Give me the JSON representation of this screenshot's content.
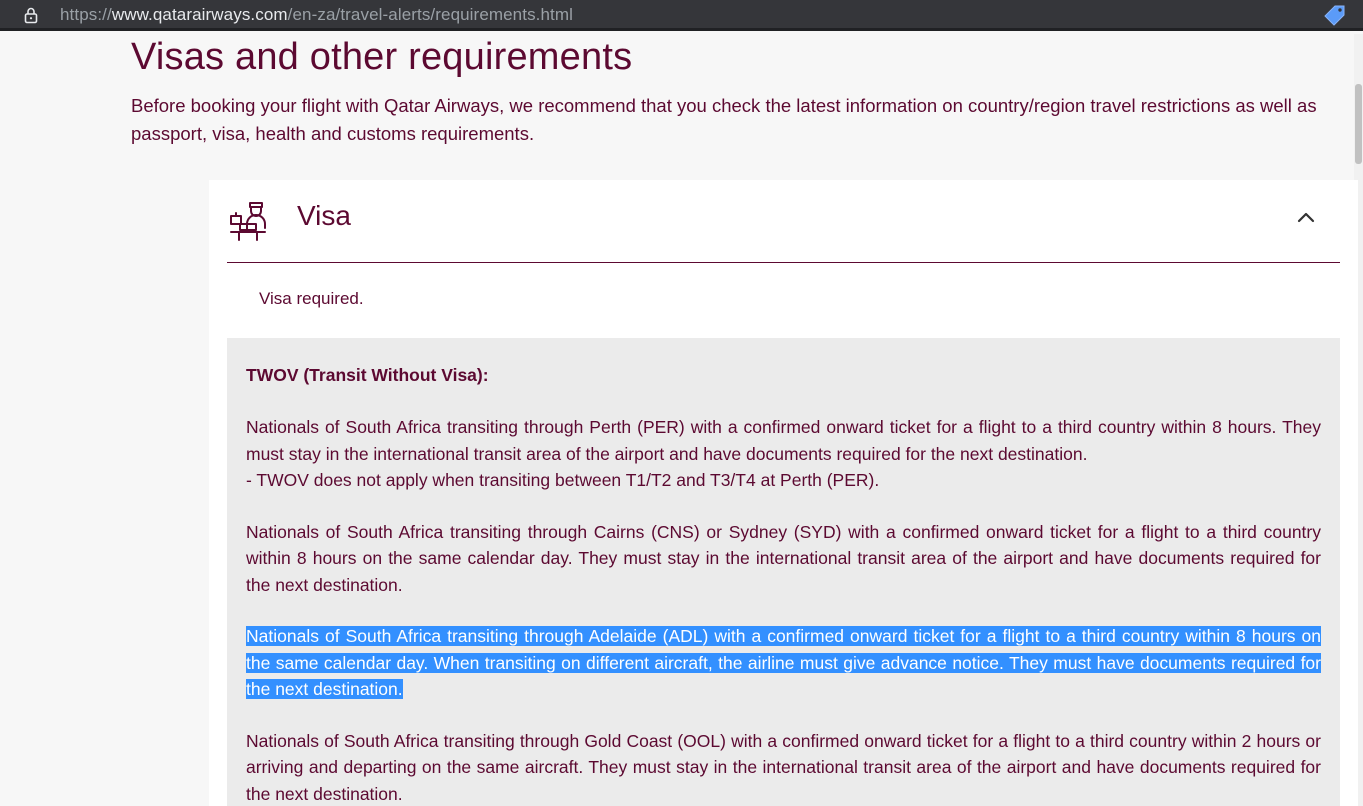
{
  "browser": {
    "url_prefix": "https://",
    "url_host": "www.qatarairways.com",
    "url_path": "/en-za/travel-alerts/requirements.html"
  },
  "page": {
    "title": "Visas and other requirements",
    "intro": "Before booking your flight with Qatar Airways, we recommend that you check the latest information on country/region travel restrictions as well as passport, visa, health and customs requirements."
  },
  "visa_section": {
    "title": "Visa",
    "requirement": "Visa required.",
    "twov": {
      "heading": "TWOV (Transit Without Visa):",
      "p1": "Nationals of South Africa transiting through Perth (PER) with a confirmed onward ticket for a flight to a third country within 8 hours. They must stay in the international transit area of the airport and have documents required for the next destination.",
      "p1_note": "- TWOV does not apply when transiting between T1/T2 and T3/T4 at Perth (PER).",
      "p2": "Nationals of South Africa transiting through Cairns (CNS) or Sydney (SYD) with a confirmed onward ticket for a flight to a third country within 8 hours on the same calendar day. They must stay in the international transit area of the airport and have documents required for the next destination.",
      "p3": "Nationals of South Africa transiting through Adelaide (ADL) with a confirmed onward ticket for a flight to a third country within 8 hours on the same calendar day. When transiting on different aircraft, the airline must give advance notice. They must have documents required for the next destination.",
      "p4": "Nationals of South Africa transiting through Gold Coast (OOL) with a confirmed onward ticket for a flight to a third country within 2 hours or arriving and departing on the same aircraft. They must stay in the international transit area of the airport and have documents required for the next destination."
    }
  },
  "colors": {
    "brand": "#5c0931",
    "selection": "#3390ff",
    "panel_bg": "#ebebeb"
  },
  "icons": {
    "lock": "lock-icon",
    "tag": "tag-icon",
    "visa": "passport-officer-icon",
    "collapse": "chevron-up-icon"
  }
}
